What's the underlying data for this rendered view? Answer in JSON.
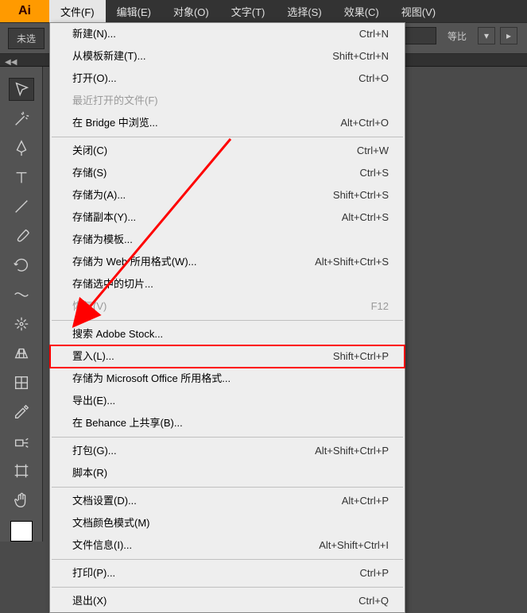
{
  "app": {
    "icon_label": "Ai"
  },
  "menubar": {
    "items": [
      {
        "label": "文件(F)"
      },
      {
        "label": "编辑(E)"
      },
      {
        "label": "对象(O)"
      },
      {
        "label": "文字(T)"
      },
      {
        "label": "选择(S)"
      },
      {
        "label": "效果(C)"
      },
      {
        "label": "视图(V)"
      }
    ]
  },
  "options": {
    "no_selection": "未选",
    "ratio_label": "等比"
  },
  "strip": {
    "arrows": "◀◀"
  },
  "dropdown": {
    "groups": [
      [
        {
          "label": "新建(N)...",
          "shortcut": "Ctrl+N",
          "disabled": false
        },
        {
          "label": "从模板新建(T)...",
          "shortcut": "Shift+Ctrl+N",
          "disabled": false
        },
        {
          "label": "打开(O)...",
          "shortcut": "Ctrl+O",
          "disabled": false
        },
        {
          "label": "最近打开的文件(F)",
          "shortcut": "",
          "disabled": true
        },
        {
          "label": "在 Bridge 中浏览...",
          "shortcut": "Alt+Ctrl+O",
          "disabled": false
        }
      ],
      [
        {
          "label": "关闭(C)",
          "shortcut": "Ctrl+W",
          "disabled": false
        },
        {
          "label": "存储(S)",
          "shortcut": "Ctrl+S",
          "disabled": false
        },
        {
          "label": "存储为(A)...",
          "shortcut": "Shift+Ctrl+S",
          "disabled": false
        },
        {
          "label": "存储副本(Y)...",
          "shortcut": "Alt+Ctrl+S",
          "disabled": false
        },
        {
          "label": "存储为模板...",
          "shortcut": "",
          "disabled": false
        },
        {
          "label": "存储为 Web 所用格式(W)...",
          "shortcut": "Alt+Shift+Ctrl+S",
          "disabled": false
        },
        {
          "label": "存储选中的切片...",
          "shortcut": "",
          "disabled": false
        },
        {
          "label": "恢复(V)",
          "shortcut": "F12",
          "disabled": true
        }
      ],
      [
        {
          "label": "搜索 Adobe Stock...",
          "shortcut": "",
          "disabled": false
        },
        {
          "label": "置入(L)...",
          "shortcut": "Shift+Ctrl+P",
          "disabled": false,
          "highlighted": true
        },
        {
          "label": "存储为 Microsoft Office 所用格式...",
          "shortcut": "",
          "disabled": false
        },
        {
          "label": "导出(E)...",
          "shortcut": "",
          "disabled": false
        },
        {
          "label": "在 Behance 上共享(B)...",
          "shortcut": "",
          "disabled": false
        }
      ],
      [
        {
          "label": "打包(G)...",
          "shortcut": "Alt+Shift+Ctrl+P",
          "disabled": false
        },
        {
          "label": "脚本(R)",
          "shortcut": "",
          "disabled": false
        }
      ],
      [
        {
          "label": "文档设置(D)...",
          "shortcut": "Alt+Ctrl+P",
          "disabled": false
        },
        {
          "label": "文档颜色模式(M)",
          "shortcut": "",
          "disabled": false
        },
        {
          "label": "文件信息(I)...",
          "shortcut": "Alt+Shift+Ctrl+I",
          "disabled": false
        }
      ],
      [
        {
          "label": "打印(P)...",
          "shortcut": "Ctrl+P",
          "disabled": false
        }
      ],
      [
        {
          "label": "退出(X)",
          "shortcut": "Ctrl+Q",
          "disabled": false
        }
      ]
    ]
  },
  "tools": [
    "selection",
    "magic-wand",
    "pen",
    "type",
    "line",
    "paintbrush",
    "rotate",
    "width",
    "free-transform",
    "perspective",
    "mesh",
    "eyedropper",
    "symbol-sprayer",
    "artboard",
    "hand"
  ]
}
